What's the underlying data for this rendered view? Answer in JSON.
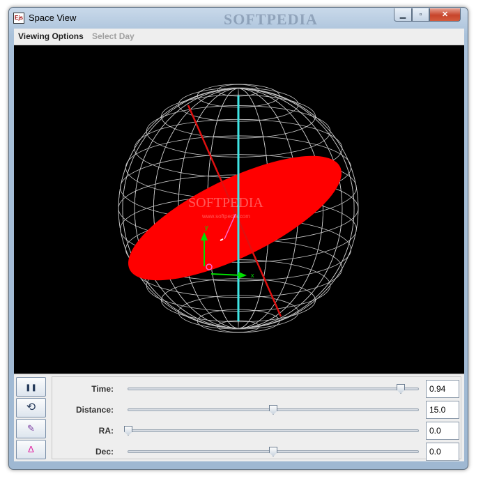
{
  "window": {
    "title": "Space View",
    "watermark": "SOFTPEDIA",
    "icon_text": "Ejs",
    "buttons": {
      "minimize": "minimize-icon",
      "maximize": "maximize-icon",
      "close": "close-icon"
    }
  },
  "menubar": {
    "items": [
      {
        "label": "Viewing Options",
        "enabled": true
      },
      {
        "label": "Select Day",
        "enabled": false
      }
    ]
  },
  "viewport": {
    "background": "#000000",
    "sphere_color": "#c8c8c8",
    "axis_color": "#3fe6e6",
    "disk_color": "#ff0000",
    "red_axis_color": "#e01010",
    "arrow_color": "#00e000",
    "watermark_text": "SOFTPEDIA",
    "watermark_url": "www.softpedia.com",
    "axis_label_y": "y",
    "axis_label_x": "x"
  },
  "toolbar": {
    "buttons": [
      {
        "name": "pause-button",
        "icon": "pause-icon",
        "glyph": "❚❚"
      },
      {
        "name": "reset-button",
        "icon": "reset-icon",
        "glyph": "⟲"
      },
      {
        "name": "clear-button",
        "icon": "eraser-icon",
        "glyph": "✎"
      },
      {
        "name": "delta-button",
        "icon": "delta-icon",
        "glyph": "Δ"
      }
    ]
  },
  "controls": [
    {
      "label": "Time:",
      "value": "0.94",
      "slider_fraction": 0.94
    },
    {
      "label": "Distance:",
      "value": "15.0",
      "slider_fraction": 0.5
    },
    {
      "label": "RA:",
      "value": "0.0",
      "slider_fraction": 0.0
    },
    {
      "label": "Dec:",
      "value": "0.0",
      "slider_fraction": 0.5
    }
  ]
}
